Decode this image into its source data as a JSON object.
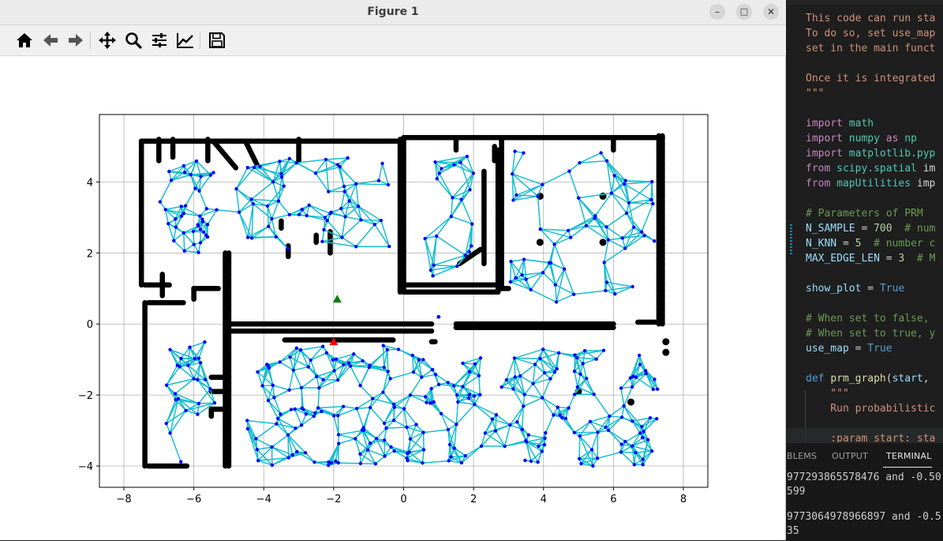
{
  "figure_window": {
    "title": "Figure 1",
    "buttons": {
      "minimize": "–",
      "maximize": "□",
      "close": "✕"
    },
    "toolbar": [
      "home-icon",
      "back-icon",
      "forward-icon",
      "pan-icon",
      "zoom-icon",
      "configure-subplots-icon",
      "edit-axes-icon",
      "save-icon"
    ]
  },
  "chart_data": {
    "type": "scatter",
    "title": "",
    "xlabel": "",
    "ylabel": "",
    "xlim": [
      -8.7,
      8.7
    ],
    "ylim": [
      -4.6,
      5.9
    ],
    "xticks": [
      -8,
      -6,
      -4,
      -2,
      0,
      2,
      4,
      6,
      8
    ],
    "yticks": [
      -4,
      -2,
      0,
      2,
      4
    ],
    "xtick_labels": [
      "−8",
      "−6",
      "−4",
      "−2",
      "0",
      "2",
      "4",
      "6",
      "8"
    ],
    "ytick_labels": [
      "−4",
      "−2",
      "0",
      "2",
      "4"
    ],
    "grid": true,
    "series": [
      {
        "kind": "obstacles",
        "color": "#000000"
      },
      {
        "kind": "prm-edges",
        "color": "#17becf"
      },
      {
        "kind": "prm-nodes",
        "color": "#0000ff"
      },
      {
        "kind": "start",
        "color": "#ff0000",
        "marker": "triangle",
        "point": [
          -2.0,
          -0.5
        ]
      },
      {
        "kind": "goal",
        "color": "#008000",
        "marker": "triangle",
        "point": [
          -1.9,
          0.7
        ]
      }
    ],
    "extra_point": [
      1.0,
      0.2
    ]
  },
  "editor": {
    "code": [
      "This code can run sta",
      "To do so, set use_map",
      "set in the main funct",
      "",
      "Once it is integrated",
      "\"\"\"",
      "",
      "import math",
      "import numpy as np",
      "import matplotlib.pyp",
      "from scipy.spatial im",
      "from mapUtilities imp",
      "",
      "# Parameters of PRM",
      "N_SAMPLE = 700  # num",
      "N_KNN = 5  # number c",
      "MAX_EDGE_LEN = 3  # M",
      "",
      "show_plot = True",
      "",
      "# When set to false, ",
      "# When set to true, y",
      "use_map = True",
      "",
      "def prm_graph(start, ",
      "    \"\"\"",
      "    Run probabilistic",
      "",
      "    :param start: sta"
    ]
  },
  "panel": {
    "tabs": [
      "BLEMS",
      "OUTPUT",
      "TERMINAL"
    ],
    "terminal_lines": [
      "977293865578476 and -0.50",
      "599",
      "",
      "9773064978966897 and -0.5",
      "35"
    ]
  }
}
